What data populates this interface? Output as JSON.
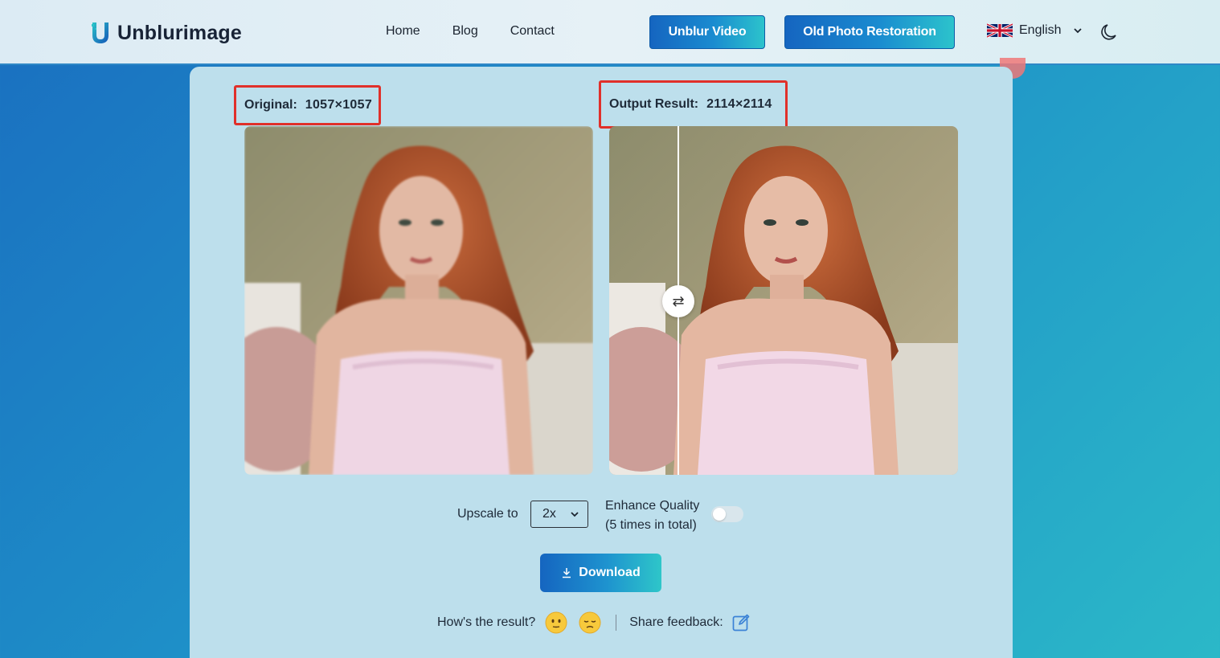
{
  "header": {
    "logo_text": "Unblurimage",
    "nav": [
      "Home",
      "Blog",
      "Contact"
    ],
    "btn_video": "Unblur Video",
    "btn_restore": "Old Photo Restoration",
    "language": "English",
    "icons": {
      "flag": "uk-flag-icon",
      "chevron": "chevron-down-icon",
      "theme": "moon-icon"
    }
  },
  "compare": {
    "original_label": "Original:",
    "original_value": "1057×1057",
    "output_label": "Output Result:",
    "output_value": "2114×2114",
    "slider_icon": "⇄"
  },
  "controls": {
    "upscale_label": "Upscale to",
    "upscale_value": "2x",
    "enhance_line1": "Enhance Quality",
    "enhance_line2": "(5 times in total)",
    "enhance_enabled": false,
    "download_label": "Download"
  },
  "feedback": {
    "question": "How's the result?",
    "share_label": "Share feedback:",
    "icons": [
      "neutral-face-icon",
      "pensive-face-icon",
      "edit-icon"
    ]
  },
  "colors": {
    "accent_start": "#1565c0",
    "accent_end": "#2cc3cc",
    "highlight_border": "#e0302a"
  }
}
